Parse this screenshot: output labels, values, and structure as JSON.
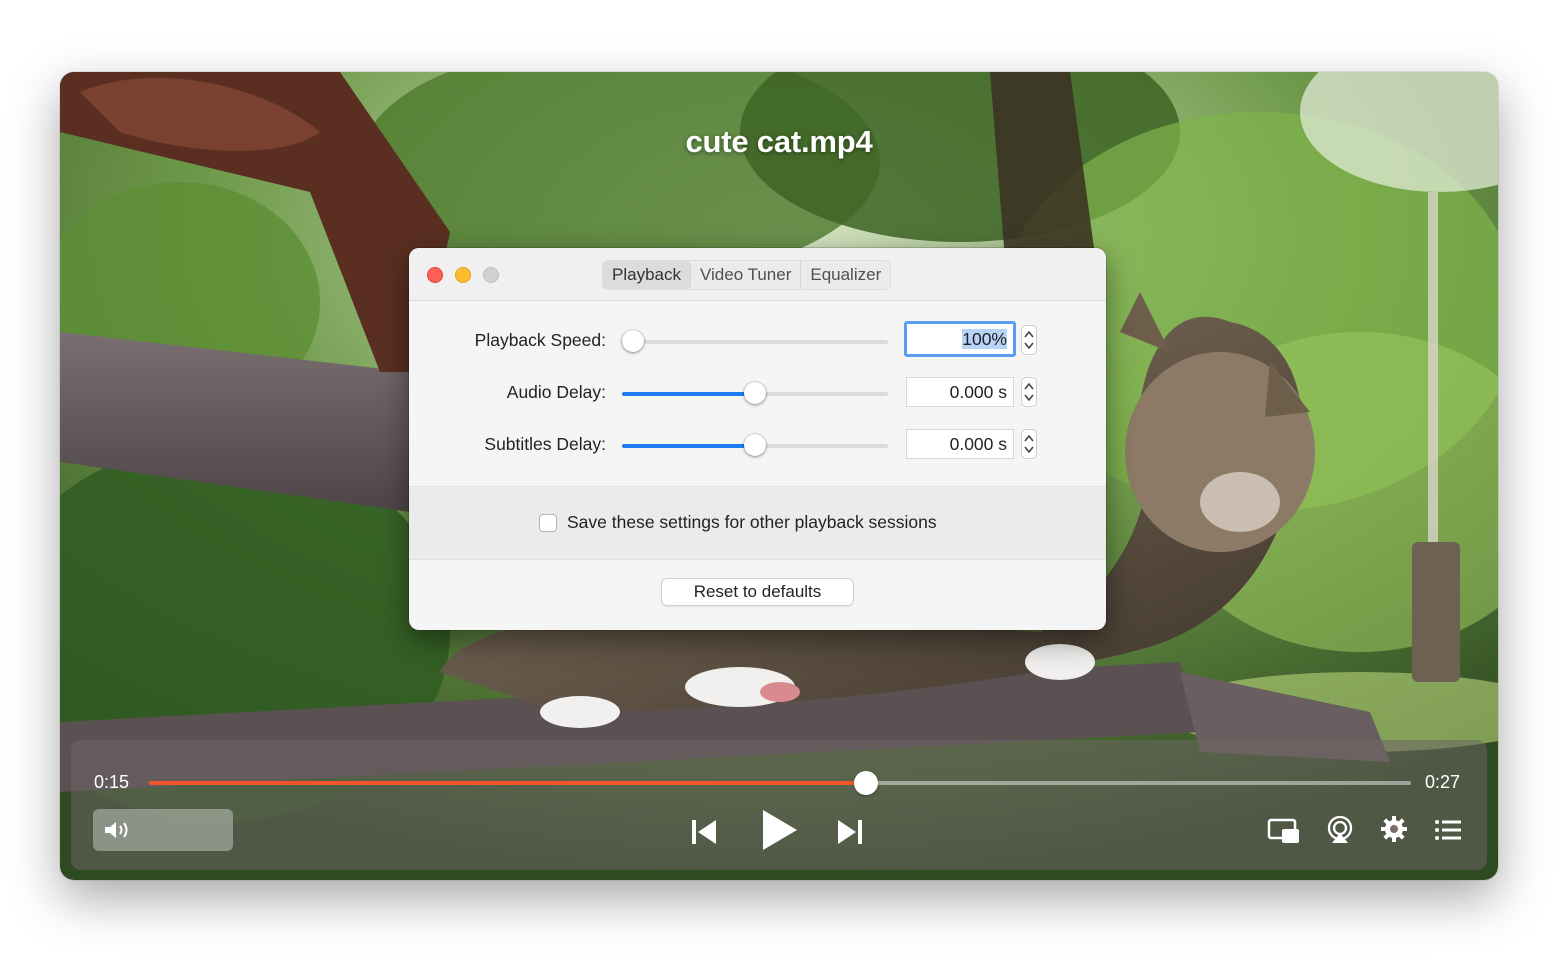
{
  "video": {
    "title": "cute cat.mp4"
  },
  "dialog": {
    "tabs": [
      {
        "label": "Playback",
        "active": true
      },
      {
        "label": "Video Tuner",
        "active": false
      },
      {
        "label": "Equalizer",
        "active": false
      }
    ],
    "playback_speed": {
      "label": "Playback Speed:",
      "value": "100%",
      "slider_fraction": 0.04
    },
    "audio_delay": {
      "label": "Audio Delay:",
      "value": "0.000 s",
      "slider_fraction": 0.5
    },
    "subtitles_delay": {
      "label": "Subtitles Delay:",
      "value": "0.000 s",
      "slider_fraction": 0.5
    },
    "save_settings": {
      "label": "Save these settings for other playback sessions",
      "checked": false
    },
    "reset_label": "Reset to defaults"
  },
  "controls": {
    "current_time": "0:15",
    "duration": "0:27",
    "progress_fraction": 0.568,
    "icons": [
      "volume-icon",
      "previous-icon",
      "play-icon",
      "next-icon",
      "picture-in-picture-icon",
      "airplay-icon",
      "settings-gear-icon",
      "playlist-icon"
    ]
  },
  "colors": {
    "progress": "#f2552c",
    "slider_accent": "#1f7cf5",
    "focus_ring": "#5b9bf0"
  }
}
